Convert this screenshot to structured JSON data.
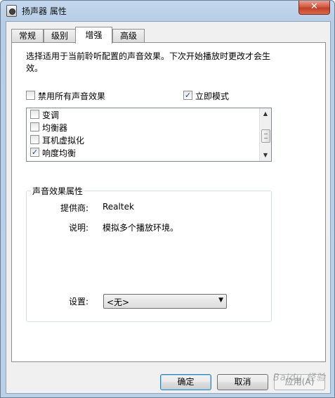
{
  "window": {
    "title": "扬声器 属性",
    "close_glyph": "✕"
  },
  "tabs": [
    {
      "label": "常规",
      "active": false
    },
    {
      "label": "级别",
      "active": false
    },
    {
      "label": "增强",
      "active": true
    },
    {
      "label": "高级",
      "active": false
    }
  ],
  "enhancements": {
    "description": "选择适用于当前聆听配置的声音效果。下次开始播放时更改才会生效。",
    "disable_all": {
      "label": "禁用所有声音效果",
      "checked": false
    },
    "immediate_mode": {
      "label": "立即模式",
      "checked": true
    },
    "effects": [
      {
        "label": "变调",
        "checked": false
      },
      {
        "label": "均衡器",
        "checked": false
      },
      {
        "label": "耳机虚拟化",
        "checked": false
      },
      {
        "label": "响度均衡",
        "checked": true
      }
    ],
    "properties": {
      "group_title": "声音效果属性",
      "provider_label": "提供商:",
      "provider_value": "Realtek",
      "description_label": "说明:",
      "description_value": "模拟多个播放环境。",
      "settings_label": "设置:",
      "settings_value": "<无>"
    }
  },
  "buttons": {
    "ok": "确定",
    "cancel": "取消",
    "apply": "应用(A)"
  },
  "watermark": "Baidu 经验",
  "colors": {
    "accent": "#3c7fb1",
    "checkmark": "#1b3f8a"
  }
}
